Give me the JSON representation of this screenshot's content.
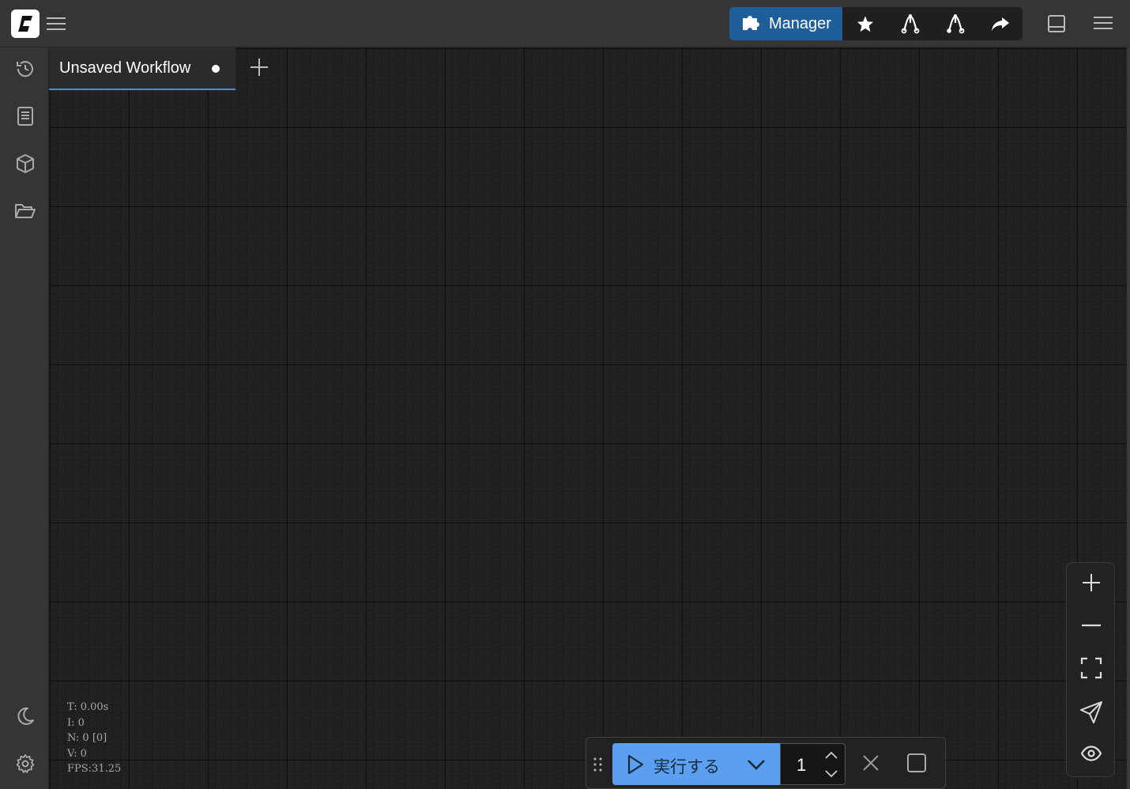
{
  "topbar": {
    "logo_icon": "comfy-logo",
    "menu_icon": "hamburger-icon",
    "manager_label": "Manager",
    "manager_icon": "puzzle-icon",
    "buttons": [
      "star-icon",
      "fork-icon",
      "fork-wrench-icon",
      "share-icon"
    ],
    "right_icons": [
      "bottom-panel-icon",
      "menu-icon"
    ]
  },
  "sidebar": {
    "top_icons": [
      "history-icon",
      "document-icon",
      "cube-icon",
      "folder-open-icon"
    ],
    "bottom_icons": [
      "moon-icon",
      "gear-icon"
    ]
  },
  "tabs": [
    {
      "label": "Unsaved Workflow",
      "modified": true
    }
  ],
  "stats": {
    "time": "T: 0.00s",
    "iterations": "I: 0",
    "nodes": "N: 0 [0]",
    "vertices": "V: 0",
    "fps": "FPS:31.25"
  },
  "zoom_controls": [
    "zoom-in-icon",
    "zoom-out-icon",
    "fit-view-icon",
    "locate-icon",
    "eye-icon"
  ],
  "runbar": {
    "run_label": "実行する",
    "batch_count": "1"
  },
  "colors": {
    "accent_blue": "#5a9ff0",
    "manager_blue": "#1e5f9a",
    "canvas_bg": "#212121",
    "chrome_bg": "#353535"
  }
}
